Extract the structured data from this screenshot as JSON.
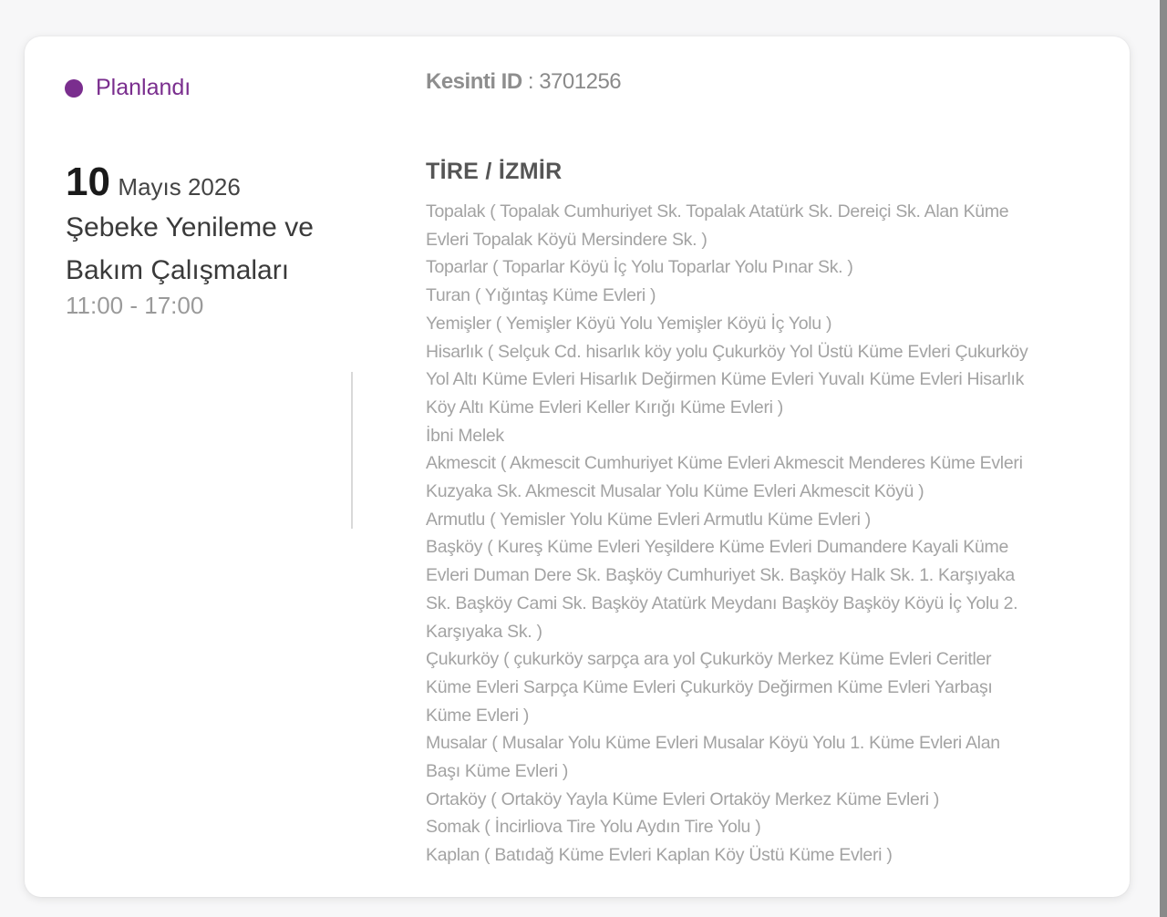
{
  "status": {
    "label": "Planlandı",
    "color": "#7a2e8e"
  },
  "outage": {
    "id_label": "Kesinti ID",
    "id_separator": " : ",
    "id_value": "3701256"
  },
  "date": {
    "day": "10",
    "month_year": "Mayıs 2026"
  },
  "work": {
    "title": "Şebeke Yenileme ve Bakım Çalışmaları",
    "time_range": "11:00 - 17:00"
  },
  "region": {
    "title": "TİRE / İZMİR"
  },
  "districts": [
    "Topalak ( Topalak Cumhuriyet Sk. Topalak Atatürk Sk. Dereiçi Sk. Alan Küme Evleri Topalak Köyü Mersindere Sk. )",
    "Toparlar ( Toparlar Köyü İç Yolu Toparlar Yolu Pınar Sk. )",
    "Turan ( Yığıntaş Küme Evleri )",
    "Yemişler ( Yemişler Köyü Yolu Yemişler Köyü İç Yolu )",
    "Hisarlık ( Selçuk Cd. hisarlık köy yolu Çukurköy Yol Üstü Küme Evleri Çukurköy Yol Altı Küme Evleri Hisarlık Değirmen Küme Evleri Yuvalı Küme Evleri Hisarlık Köy Altı Küme Evleri Keller Kırığı Küme Evleri )",
    "İbni Melek",
    "Akmescit ( Akmescit Cumhuriyet Küme Evleri Akmescit Menderes Küme Evleri Kuzyaka Sk. Akmescit Musalar Yolu Küme Evleri Akmescit Köyü )",
    "Armutlu ( Yemisler Yolu Küme Evleri Armutlu Küme Evleri )",
    "Başköy ( Kureş Küme Evleri Yeşildere Küme Evleri Dumandere Kayali Küme Evleri Duman Dere Sk. Başköy Cumhuriyet Sk. Başköy Halk Sk. 1. Karşıyaka Sk. Başköy Cami Sk. Başköy Atatürk Meydanı Başköy Başköy Köyü İç Yolu 2. Karşıyaka Sk. )",
    "Çukurköy ( çukurköy sarpça ara yol Çukurköy Merkez Küme Evleri Ceritler Küme Evleri Sarpça Küme Evleri Çukurköy Değirmen Küme Evleri Yarbaşı Küme Evleri )",
    "Musalar ( Musalar Yolu Küme Evleri Musalar Köyü Yolu 1. Küme Evleri Alan Başı Küme Evleri )",
    "Ortaköy ( Ortaköy Yayla Küme Evleri Ortaköy Merkez Küme Evleri )",
    "Somak ( İncirliova Tire Yolu Aydın Tire Yolu )",
    "Kaplan ( Batıdağ Küme Evleri Kaplan Köy Üstü Küme Evleri )"
  ]
}
